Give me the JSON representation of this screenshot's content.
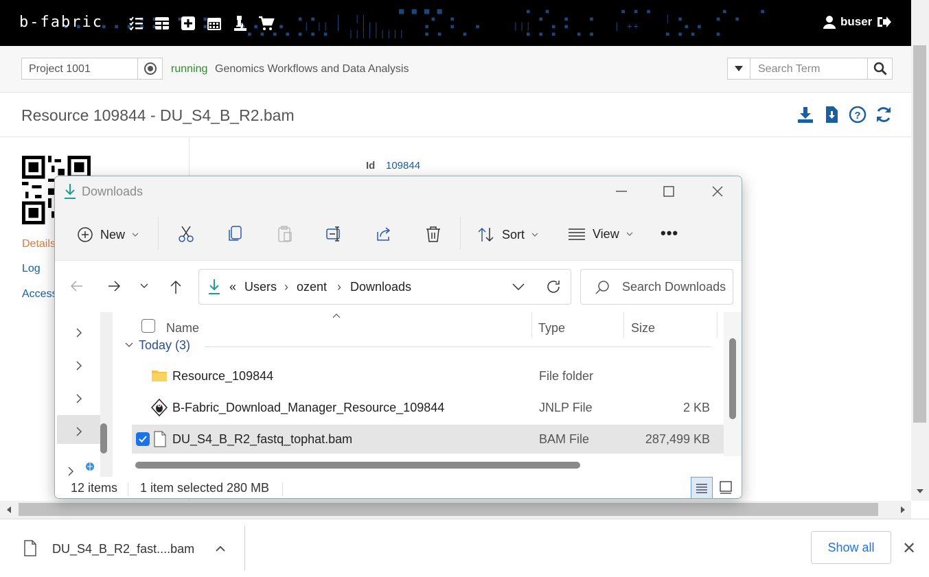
{
  "app": {
    "logo": "b-fabric",
    "username": "buser"
  },
  "project_bar": {
    "project_value": "Project 1001",
    "status": "running",
    "project_name": "Genomics Workflows and Data Analysis",
    "search_placeholder": "Search Term"
  },
  "page": {
    "title": "Resource 109844 - DU_S4_B_R2.bam",
    "left_links": [
      "Details",
      "Log",
      "Access"
    ],
    "id_label": "Id",
    "id_value": "109844"
  },
  "explorer": {
    "title": "Downloads",
    "toolbar": {
      "new_label": "New",
      "sort_label": "Sort",
      "view_label": "View",
      "more_label": "•••"
    },
    "breadcrumb": {
      "overflow": "«",
      "items": [
        "Users",
        "ozent",
        "Downloads"
      ]
    },
    "search_placeholder": "Search Downloads",
    "columns": {
      "name": "Name",
      "type": "Type",
      "size": "Size"
    },
    "group_label": "Today (3)",
    "files": [
      {
        "name": "Resource_109844",
        "type": "File folder",
        "size": "",
        "icon": "folder-icon",
        "selected": false
      },
      {
        "name": "B-Fabric_Download_Manager_Resource_109844",
        "type": "JNLP File",
        "size": "2 KB",
        "icon": "java-icon",
        "selected": false
      },
      {
        "name": "DU_S4_B_R2_fastq_tophat.bam",
        "type": "BAM File",
        "size": "287,499 KB",
        "icon": "file-icon",
        "selected": true
      }
    ],
    "status": {
      "item_count": "12 items",
      "selection": "1 item selected",
      "selection_size": "280 MB"
    }
  },
  "download_bar": {
    "file_label": "DU_S4_B_R2_fast....bam",
    "show_all_label": "Show all"
  },
  "colors": {
    "accent_link": "#1a5fa0",
    "status_running": "#2e8b2e",
    "details_link": "#e07b39",
    "downloads_icon": "#1a9f8f",
    "checkbox_blue": "#1a73e8"
  }
}
